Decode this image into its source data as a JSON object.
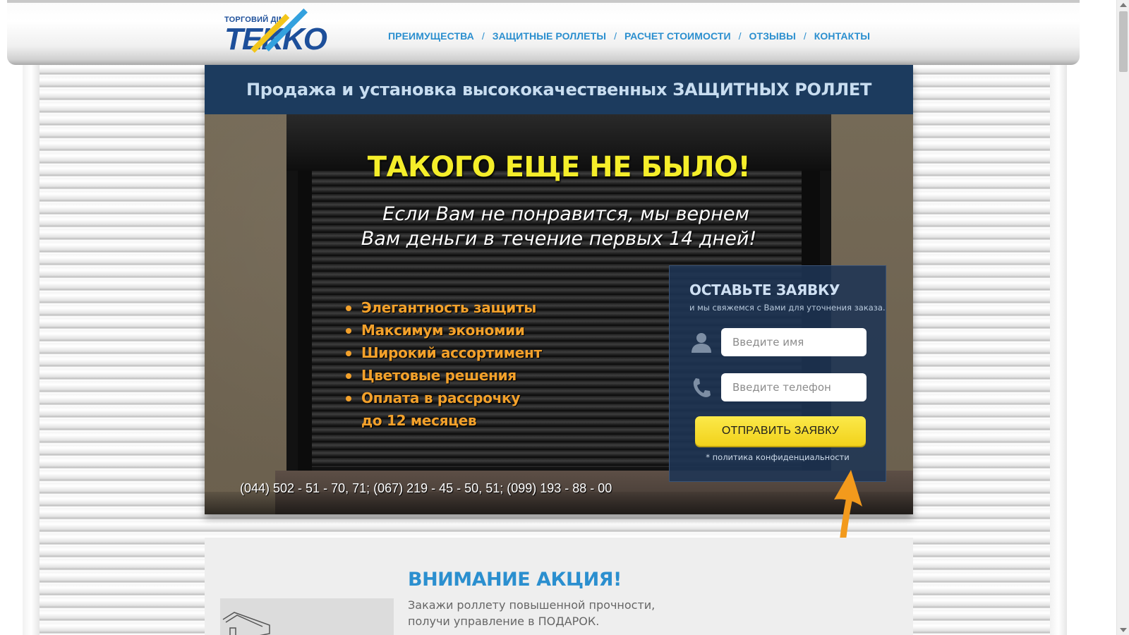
{
  "brand": {
    "small_text": "ТОРГОВИЙ ДІМ",
    "logo_text": "TEKKO",
    "colors": {
      "blue": "#1d4f9a",
      "yellow": "#f3c61b",
      "light_blue": "#33a1de"
    }
  },
  "nav": {
    "items": [
      {
        "label": "ПРЕИМУЩЕСТВА"
      },
      {
        "label": "ЗАЩИТНЫЕ РОЛЛЕТЫ"
      },
      {
        "label": "РАСЧЕТ СТОИМОСТИ"
      },
      {
        "label": "ОТЗЫВЫ"
      },
      {
        "label": "КОНТАКТЫ"
      }
    ],
    "separator": "/"
  },
  "hero": {
    "title": "Продажа и установка высококачественных ЗАЩИТНЫХ РОЛЛЕТ",
    "headline": "ТАКОГО ЕЩЕ НЕ БЫЛО!",
    "subline_1": "Если Вам не понравится, мы вернем",
    "subline_2": "Вам деньги в течение первых 14 дней!",
    "bullets": [
      "Элегантность защиты",
      "Максимум экономии",
      "Широкий ассортимент",
      "Цветовые решения",
      "Оплата в рассрочку"
    ],
    "bullet_continuation": "до 12 месяцев",
    "phones": "(044) 502 - 51 - 70, 71; (067) 219 - 45 - 50, 51; (099) 193 - 88 - 00",
    "colors": {
      "headline": "#f5ee2a",
      "bullets": "#f3a12b",
      "title_bar": "#1c3b5e"
    }
  },
  "form": {
    "title": "ОСТАВЬТЕ ЗАЯВКУ",
    "subtitle": "и мы свяжемся с Вами для уточнения заказа.",
    "name_placeholder": "Введите имя",
    "phone_placeholder": "Введите телефон",
    "name_icon": "user-icon",
    "phone_icon": "phone-icon",
    "submit_label": "ОТПРАВИТЬ ЗАЯВКУ",
    "policy_link": "* политика конфиденциальности",
    "colors": {
      "button": "#f2d21b",
      "panel": "#1e3454"
    }
  },
  "promo": {
    "title": "ВНИМАНИЕ АКЦИЯ!",
    "text_line_1": "Закажи роллету повышенной прочности,",
    "text_line_2": "получи управление в ПОДАРОК."
  },
  "decor": {
    "arrow_color": "#f39a1c"
  }
}
